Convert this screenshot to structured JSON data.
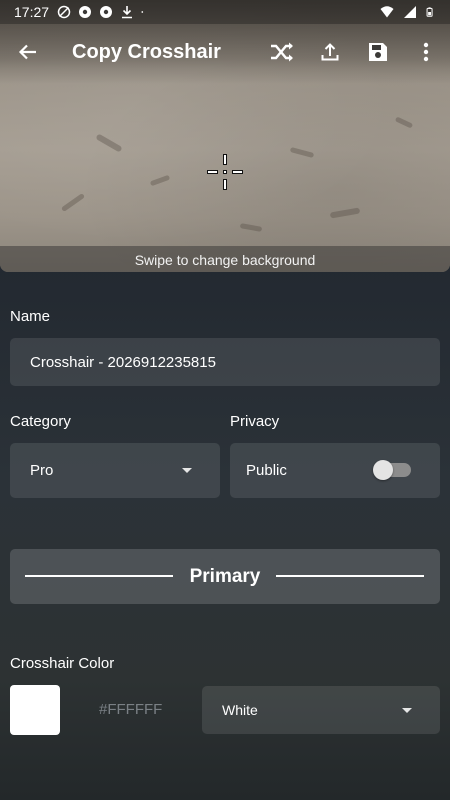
{
  "status_bar": {
    "time": "17:27",
    "left_icons": [
      "sync-off-icon",
      "aperture-icon",
      "aperture-icon",
      "download-icon",
      "dot-icon"
    ],
    "right_icons": [
      "wifi-icon",
      "signal-icon",
      "battery-icon"
    ]
  },
  "app_bar": {
    "title": "Copy Crosshair",
    "actions": [
      "shuffle-icon",
      "upload-icon",
      "save-icon",
      "more-vert-icon"
    ]
  },
  "preview": {
    "hint": "Swipe to change background"
  },
  "form": {
    "name_label": "Name",
    "name_value": "Crosshair - 2026912235815",
    "category_label": "Category",
    "category_value": "Pro",
    "privacy_label": "Privacy",
    "privacy_value": "Public",
    "privacy_enabled": false,
    "section_title": "Primary",
    "color_label": "Crosshair Color",
    "color_hex": "#FFFFFF",
    "color_name": "White"
  },
  "colors": {
    "crosshair": "#FFFFFF",
    "swatch": "#FFFFFF"
  }
}
